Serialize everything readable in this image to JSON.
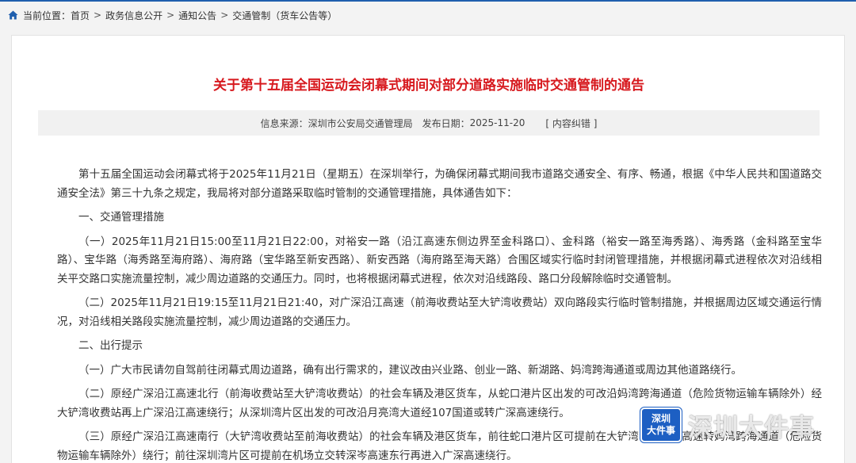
{
  "breadcrumb": {
    "location_label": "当前位置：",
    "items": [
      "首页",
      "政务信息公开",
      "通知公告",
      "交通管制（货车公告等）"
    ],
    "separator": ">"
  },
  "article": {
    "title": "关于第十五届全国运动会闭幕式期间对部分道路实施临时交通管制的通告",
    "meta": {
      "source_label": "信息来源：",
      "source": "深圳市公安局交通管理局",
      "date_label": "发布日期：",
      "date": "2025-11-20",
      "correction_link": "[ 内容纠错 ]"
    },
    "paragraphs": [
      "第十五届全国运动会闭幕式将于2025年11月21日（星期五）在深圳举行，为确保闭幕式期间我市道路交通安全、有序、畅通，根据《中华人民共和国道路交通安全法》第三十九条之规定，我局将对部分道路采取临时管制的交通管理措施，具体通告如下：",
      "一、交通管理措施",
      "（一）2025年11月21日15:00至11月21日22:00，对裕安一路（沿江高速东侧边界至金科路口）、金科路（裕安一路至海秀路）、海秀路（金科路至宝华路）、宝华路（海秀路至海府路）、海府路（宝华路至新安西路）、新安西路（海府路至海天路）合围区域实行临时封闭管理措施，并根据闭幕式进程依次对沿线相关平交路口实施流量控制，减少周边道路的交通压力。同时，也将根据闭幕式进程，依次对沿线路段、路口分段解除临时交通管制。",
      "（二）2025年11月21日19:15至11月21日21:40，对广深沿江高速（前海收费站至大铲湾收费站）双向路段实行临时管制措施，并根据周边区域交通运行情况，对沿线相关路段实施流量控制，减少周边道路的交通压力。",
      "二、出行提示",
      "（一）广大市民请勿自驾前往闭幕式周边道路，确有出行需求的，建议改由兴业路、创业一路、新湖路、妈湾跨海通道或周边其他道路绕行。",
      "（二）原经广深沿江高速北行（前海收费站至大铲湾收费站）的社会车辆及港区货车，从蛇口港片区出发的可改沿妈湾跨海通道（危险货物运输车辆除外）经大铲湾收费站再上广深沿江高速绕行；从深圳湾片区出发的可改沿月亮湾大道经107国道或转广深高速绕行。",
      "（三）原经广深沿江高速南行（大铲湾收费站至前海收费站）的社会车辆及港区货车，前往蛇口港片区可提前在大铲湾收费站下高速转妈湾跨海通道（危险货物运输车辆除外）绕行；前往深圳湾片区可提前在机场立交转深岑高速东行再进入广深高速绕行。"
    ]
  },
  "watermark": {
    "logo_line1": "深圳",
    "logo_line2": "大件事",
    "text": "深圳大件事"
  },
  "colors": {
    "title": "#d7191e",
    "accent": "#1f5fae",
    "meta_bg": "#f1f1f1"
  }
}
